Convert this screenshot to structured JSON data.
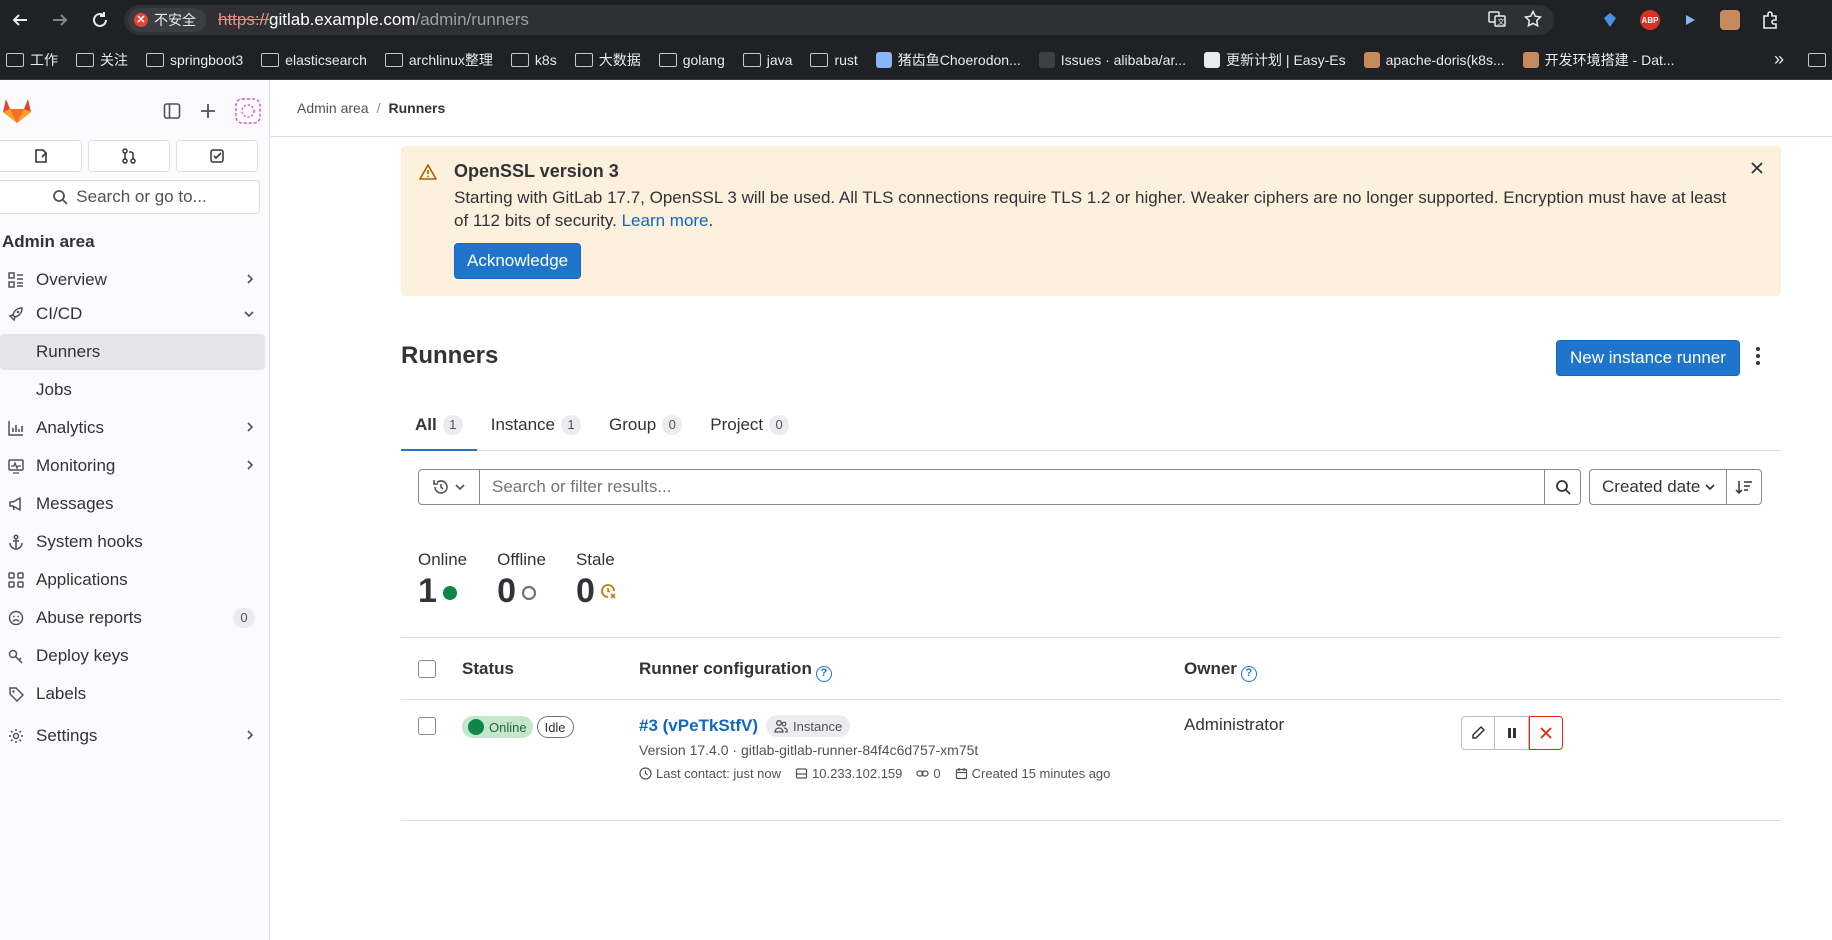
{
  "browser": {
    "insecure_label": "不安全",
    "url_scheme": "https://",
    "url_host": "gitlab.example.com",
    "url_path": "/admin/runners"
  },
  "bookmarks": [
    {
      "label": "工作",
      "kind": "folder"
    },
    {
      "label": "关注",
      "kind": "folder"
    },
    {
      "label": "springboot3",
      "kind": "folder"
    },
    {
      "label": "elasticsearch",
      "kind": "folder"
    },
    {
      "label": "archlinux整理",
      "kind": "folder"
    },
    {
      "label": "k8s",
      "kind": "folder"
    },
    {
      "label": "大数据",
      "kind": "folder"
    },
    {
      "label": "golang",
      "kind": "folder"
    },
    {
      "label": "java",
      "kind": "folder"
    },
    {
      "label": "rust",
      "kind": "folder"
    },
    {
      "label": "猪齿鱼Choerodon...",
      "kind": "site"
    },
    {
      "label": "Issues · alibaba/ar...",
      "kind": "site"
    },
    {
      "label": "更新计划 | Easy-Es",
      "kind": "site"
    },
    {
      "label": "apache-doris(k8s...",
      "kind": "site"
    },
    {
      "label": "开发环境搭建 - Dat...",
      "kind": "site"
    }
  ],
  "bookmarks_more": "»",
  "sidebar": {
    "search_placeholder": "Search or go to...",
    "section_title": "Admin area",
    "items": {
      "overview": "Overview",
      "cicd": "CI/CD",
      "runners": "Runners",
      "jobs": "Jobs",
      "analytics": "Analytics",
      "monitoring": "Monitoring",
      "messages": "Messages",
      "system_hooks": "System hooks",
      "applications": "Applications",
      "abuse_reports": "Abuse reports",
      "abuse_reports_count": "0",
      "deploy_keys": "Deploy keys",
      "labels": "Labels",
      "settings": "Settings"
    }
  },
  "breadcrumb": {
    "root": "Admin area",
    "separator": "/",
    "current": "Runners"
  },
  "banner": {
    "title": "OpenSSL version 3",
    "body": "Starting with GitLab 17.7, OpenSSL 3 will be used. All TLS connections require TLS 1.2 or higher. Weaker ciphers are no longer supported. Encryption must have at least of 112 bits of security.",
    "link": "Learn more",
    "link_suffix": ".",
    "button": "Acknowledge"
  },
  "page": {
    "title": "Runners",
    "new_button": "New instance runner"
  },
  "tabs": [
    {
      "label": "All",
      "count": "1"
    },
    {
      "label": "Instance",
      "count": "1"
    },
    {
      "label": "Group",
      "count": "0"
    },
    {
      "label": "Project",
      "count": "0"
    }
  ],
  "filter": {
    "placeholder": "Search or filter results...",
    "sort_label": "Created date"
  },
  "stats": {
    "online_label": "Online",
    "online_value": "1",
    "offline_label": "Offline",
    "offline_value": "0",
    "stale_label": "Stale",
    "stale_value": "0"
  },
  "table": {
    "headers": {
      "status": "Status",
      "config": "Runner configuration",
      "owner": "Owner"
    },
    "rows": [
      {
        "status": "Online",
        "state": "Idle",
        "runner_name": "#3 (vPeTkStfV)",
        "runner_type": "Instance",
        "version_line": "Version 17.4.0 · gitlab-gitlab-runner-84f4c6d757-xm75t",
        "last_contact": "Last contact: just now",
        "ip": "10.233.102.159",
        "jobs": "0",
        "created": "Created 15 minutes ago",
        "owner": "Administrator"
      }
    ]
  },
  "colors": {
    "primary": "#1f75cb",
    "online": "#108548",
    "warning_bg": "#fdf1dd",
    "danger": "#dd2b0e"
  }
}
